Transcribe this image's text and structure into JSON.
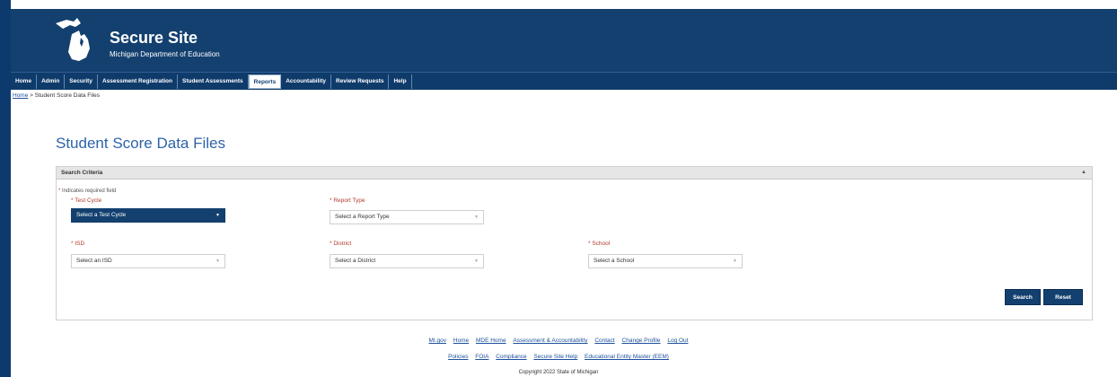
{
  "header": {
    "title": "Secure Site",
    "subtitle": "Michigan Department of Education",
    "logo_icon": "michigan-mitten-icon"
  },
  "nav": {
    "items": [
      {
        "label": "Home"
      },
      {
        "label": "Admin"
      },
      {
        "label": "Security"
      },
      {
        "label": "Assessment Registration"
      },
      {
        "label": "Student Assessments"
      },
      {
        "label": "Reports",
        "active": true
      },
      {
        "label": "Accountability"
      },
      {
        "label": "Review Requests"
      },
      {
        "label": "Help"
      }
    ]
  },
  "breadcrumb": {
    "home": "Home",
    "separator": ">",
    "current": "Student Score Data Files"
  },
  "page": {
    "title": "Student Score Data Files"
  },
  "search_panel": {
    "title": "Search Criteria",
    "required_note_star": "*",
    "required_note": "Indicates required field",
    "fields": {
      "test_cycle": {
        "label": "Test Cycle",
        "value": "Select a Test Cycle"
      },
      "report_type": {
        "label": "Report Type",
        "value": "Select a Report Type"
      },
      "isd": {
        "label": "ISD",
        "value": "Select an ISD"
      },
      "district": {
        "label": "District",
        "value": "Select a District"
      },
      "school": {
        "label": "School",
        "value": "Select a School"
      }
    },
    "search_label": "Search",
    "reset_label": "Reset"
  },
  "footer": {
    "row1": [
      "MI.gov",
      "Home",
      "MDE Home",
      "Assessment & Accountability",
      "Contact",
      "Change Profile",
      "Log Out"
    ],
    "row2": [
      "Policies",
      "FOIA",
      "Compliance",
      "Secure Site Help",
      "Educational Entity Master (EEM)"
    ],
    "copyright": "Copyright 2022 State of Michigan"
  },
  "colors": {
    "brand_navy": "#13406f",
    "title_blue": "#2d63a8",
    "required_red": "#b03a2e",
    "link_blue": "#1c4f9c"
  }
}
